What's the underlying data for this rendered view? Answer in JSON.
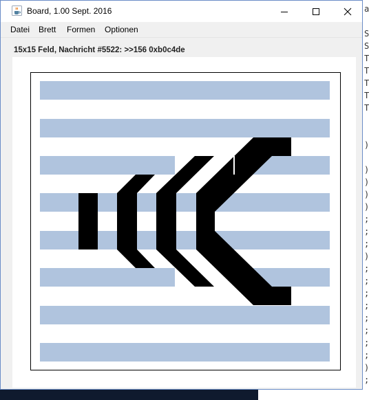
{
  "window": {
    "title": "Board, 1.00 Sept. 2016"
  },
  "menu": {
    "items": [
      "Datei",
      "Brett",
      "Formen",
      "Optionen"
    ]
  },
  "status": {
    "message": "15x15 Feld, Nachricht #5522: >>156 0xb0c4de"
  },
  "colors": {
    "stripe": "#b0c4de",
    "shape": "#000000"
  },
  "icons": {
    "app": "java-cup-icon",
    "minimize": "minimize-icon",
    "maximize": "maximize-icon",
    "close": "close-icon"
  },
  "background_code": {
    "lines": [
      "ar",
      "",
      "S",
      "S",
      "T",
      "T",
      "T",
      "T",
      "T",
      "",
      "",
      ")",
      "",
      ")",
      ")",
      ")",
      ")",
      ";",
      ";",
      ";",
      ")",
      ";",
      ";",
      ";",
      ";",
      ";",
      ";",
      ";",
      ";",
      ")",
      ";",
      ")"
    ]
  }
}
